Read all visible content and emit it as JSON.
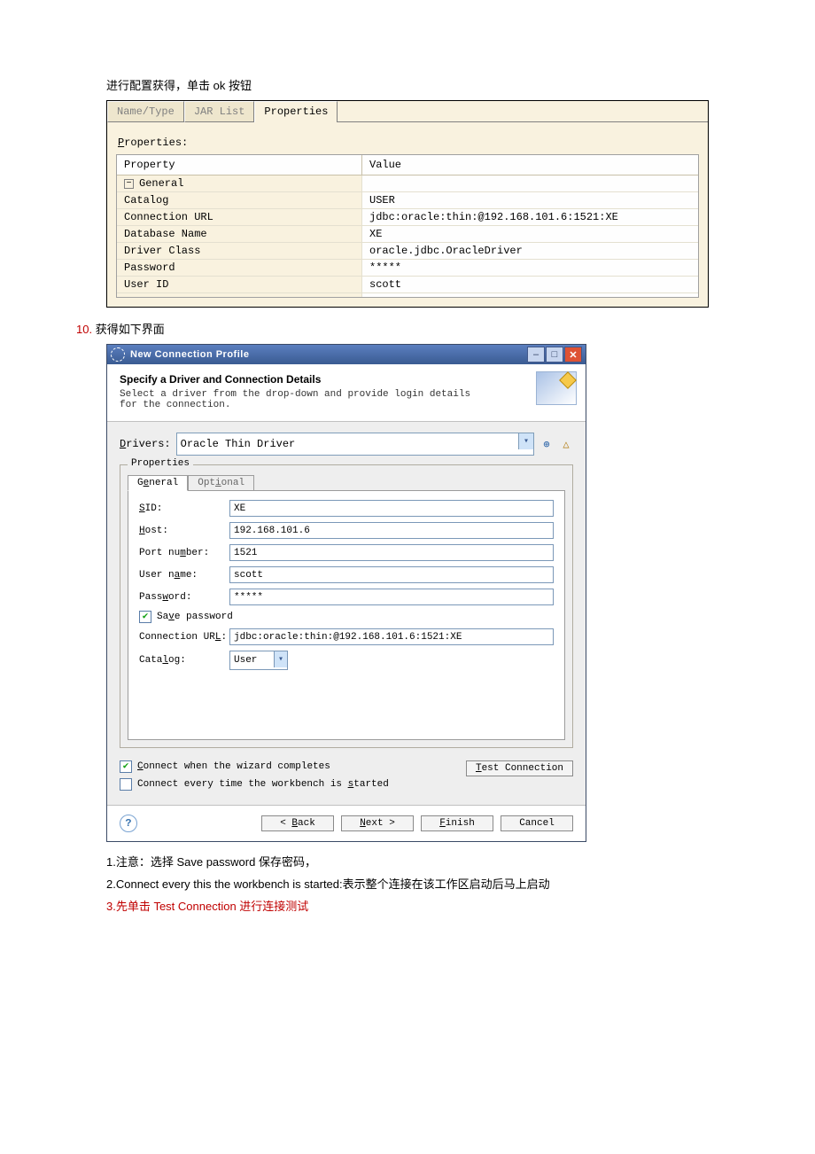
{
  "intro_text": "进行配置获得，单击 ok 按钮",
  "panel1": {
    "tabs": {
      "name_type": "Name/Type",
      "jar_list": "JAR List",
      "properties": "Properties"
    },
    "label_prefix": "P",
    "label_rest": "roperties:",
    "header": {
      "property": "Property",
      "value": "Value"
    },
    "group_label": "General",
    "rows": [
      {
        "name": "Catalog",
        "value": "USER"
      },
      {
        "name": "Connection URL",
        "value": "jdbc:oracle:thin:@192.168.101.6:1521:XE"
      },
      {
        "name": "Database Name",
        "value": "XE"
      },
      {
        "name": "Driver Class",
        "value": "oracle.jdbc.OracleDriver"
      },
      {
        "name": "Password",
        "value": "*****"
      },
      {
        "name": "User ID",
        "value": "scott"
      }
    ]
  },
  "step": {
    "num": "10.",
    "text": " 获得如下界面"
  },
  "dialog": {
    "title": "New Connection Profile",
    "banner": {
      "heading": "Specify a Driver and Connection Details",
      "sub": "Select a driver from the drop-down and provide login details for the connection."
    },
    "drivers": {
      "label_prefix": "D",
      "label_rest": "rivers:",
      "value": "Oracle Thin Driver"
    },
    "fieldset_legend": "Properties",
    "tabs": {
      "general": {
        "pre": "G",
        "u": "e",
        "post": "neral"
      },
      "optional": {
        "pre": "Opt",
        "u": "i",
        "post": "onal"
      }
    },
    "fields": {
      "sid": {
        "label_u": "S",
        "label_post": "ID:",
        "value": "XE"
      },
      "host": {
        "label_u": "H",
        "label_post": "ost:",
        "value": "192.168.101.6"
      },
      "port": {
        "label_pre": "Port nu",
        "label_u": "m",
        "label_post": "ber:",
        "value": "1521"
      },
      "user": {
        "label_pre": "User n",
        "label_u": "a",
        "label_post": "me:",
        "value": "scott"
      },
      "pass": {
        "label_pre": "Pass",
        "label_u": "w",
        "label_post": "ord:",
        "value": "*****"
      },
      "save_pw": {
        "label_pre": "Sa",
        "label_u": "v",
        "label_post": "e password"
      },
      "conn_url": {
        "label_pre": "Connection UR",
        "label_u": "L",
        "label_post": ":",
        "value": "jdbc:oracle:thin:@192.168.101.6:1521:XE"
      },
      "catalog": {
        "label_pre": "Cata",
        "label_u": "l",
        "label_post": "og:",
        "value": "User"
      }
    },
    "footer_checks": {
      "connect_complete": {
        "u": "C",
        "post": "onnect when the wizard completes"
      },
      "connect_startup": {
        "pre": "Connect every time the workbench is ",
        "u": "s",
        "post": "tarted"
      }
    },
    "buttons": {
      "test": {
        "u": "T",
        "post": "est Connection"
      },
      "back": {
        "pre": "< ",
        "u": "B",
        "post": "ack"
      },
      "next": {
        "u": "N",
        "post": "ext >"
      },
      "finish": {
        "u": "F",
        "post": "inish"
      },
      "cancel": "Cancel"
    }
  },
  "notes": {
    "l1_pre": "1.注意：选择 Save password 保存密码，",
    "l2": "2.Connect every this the workbench is started:表示整个连接在该工作区启动后马上启动",
    "l3": "3.先单击 Test Connection 进行连接测试"
  }
}
